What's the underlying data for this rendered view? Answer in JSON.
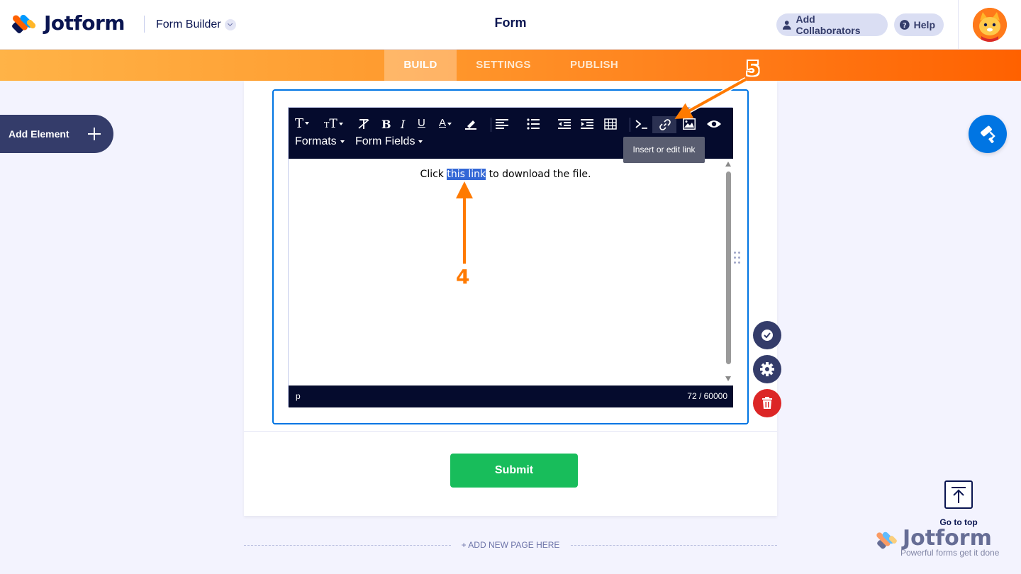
{
  "header": {
    "brand": "Jotform",
    "builder_label": "Form Builder",
    "form_title": "Form",
    "add_collaborators": "Add Collaborators",
    "help": "Help"
  },
  "nav": {
    "tabs": [
      {
        "label": "BUILD",
        "active": true
      },
      {
        "label": "SETTINGS",
        "active": false
      },
      {
        "label": "PUBLISH",
        "active": false
      }
    ]
  },
  "sidebar": {
    "add_element": "Add Element"
  },
  "editor": {
    "menus": [
      "Formats",
      "Form Fields"
    ],
    "content_before": "Click ",
    "content_selected": "this link",
    "content_after": " to download the file.",
    "status_path": "p",
    "char_count": "72 / 60000",
    "tooltip": "Insert or edit link"
  },
  "form": {
    "submit_label": "Submit",
    "add_page": "+ ADD NEW PAGE HERE"
  },
  "go_to_top": "Go to top",
  "footer": {
    "brand": "Jotform",
    "tagline": "Powerful forms get it done"
  },
  "annotations": {
    "step4": "4",
    "step5": "5"
  },
  "colors": {
    "brand_navy": "#0a1551",
    "accent_orange": "#ff6100",
    "primary_blue": "#0075e3",
    "submit_green": "#18bd5b",
    "delete_red": "#dc2626"
  }
}
